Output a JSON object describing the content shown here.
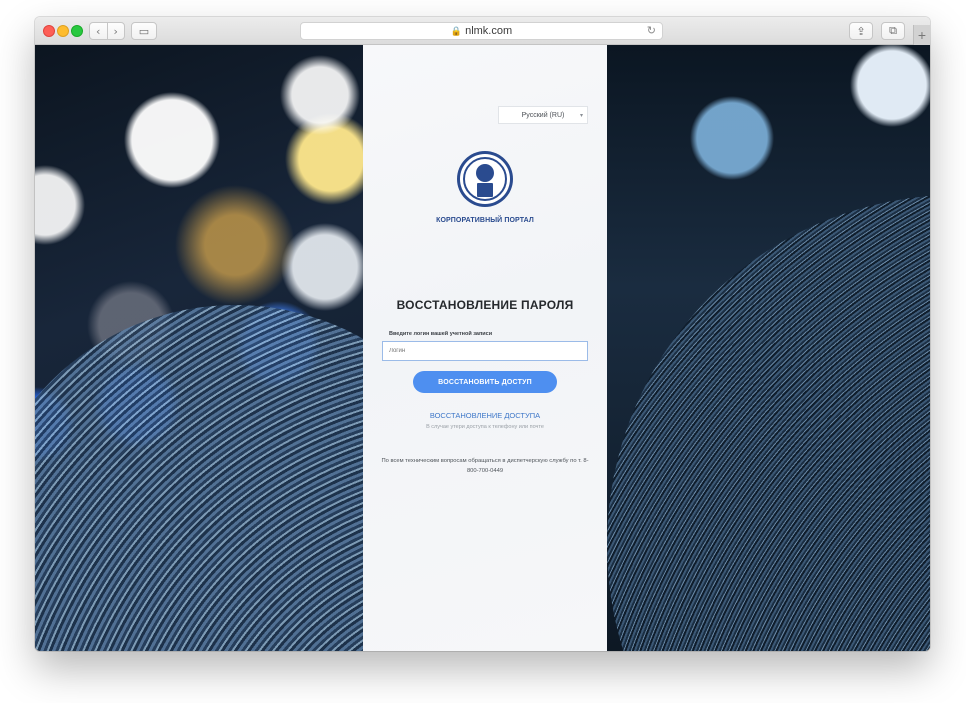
{
  "browser": {
    "address": "nlmk.com",
    "back_glyph": "‹",
    "forward_glyph": "›",
    "sidebar_glyph": "▭",
    "reload_glyph": "↻",
    "share_glyph": "⇪",
    "tabs_glyph": "⧉",
    "new_tab_glyph": "+",
    "lock_glyph": "🔒"
  },
  "page": {
    "language": "Русский (RU)",
    "language_caret": "▾",
    "portal_name": "КОРПОРАТИВНЫЙ ПОРТАЛ",
    "title": "ВОССТАНОВЛЕНИЕ ПАРОЛЯ",
    "field_label": "Введите логин вашей учетной записи",
    "login_placeholder": "Логин",
    "submit_label": "ВОССТАНОВИТЬ ДОСТУП",
    "recover_link": "ВОССТАНОВЛЕНИЕ ДОСТУПА",
    "recover_hint": "В случае утери доступа к телефону или почте",
    "support_text": "По всем техническим вопросам обращаться в диспетчерскую службу по т. 8-800-700-0449"
  },
  "colors": {
    "brand_blue": "#2a4b8f",
    "button_blue": "#4e8ff0",
    "link_blue": "#3f78c9"
  }
}
